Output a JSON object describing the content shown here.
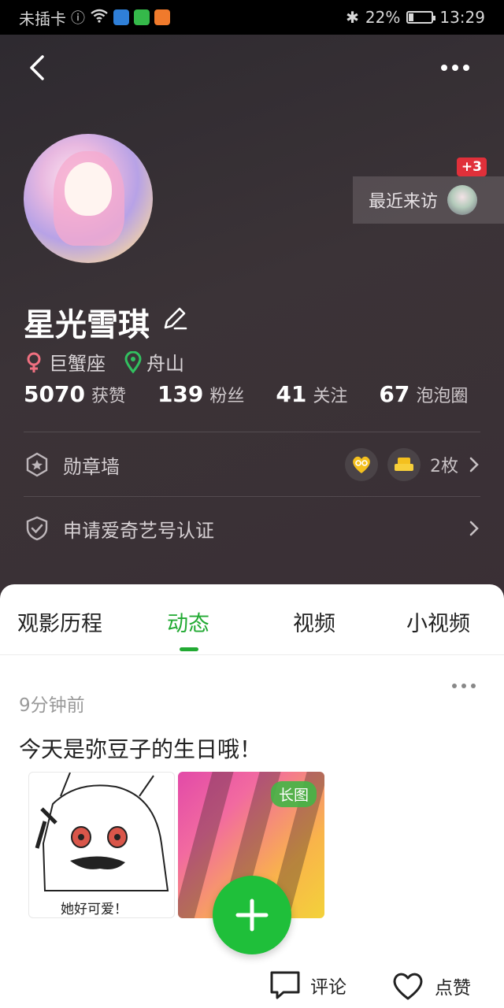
{
  "status_bar": {
    "carrier": "未插卡",
    "battery": "22%",
    "time": "13:29",
    "battery_level": 0.22
  },
  "profile": {
    "username": "星光雪琪",
    "zodiac": "巨蟹座",
    "location": "舟山",
    "stats": [
      {
        "value": "5070",
        "label": "获赞"
      },
      {
        "value": "139",
        "label": "粉丝"
      },
      {
        "value": "41",
        "label": "关注"
      },
      {
        "value": "67",
        "label": "泡泡圈"
      }
    ],
    "visitors_label": "最近来访",
    "visitors_badge": "+3"
  },
  "rows": {
    "medal_wall": "勋章墙",
    "medal_count": "2枚",
    "verify": "申请爱奇艺号认证"
  },
  "tabs": [
    "观影历程",
    "动态",
    "视频",
    "小视频"
  ],
  "active_tab": 1,
  "post": {
    "time": "9分钟前",
    "text": "今天是弥豆子的生日哦！",
    "image1_caption": "她好可爱！",
    "long_image_badge": "长图"
  },
  "actions": {
    "comment": "评论",
    "like": "点赞"
  },
  "colors": {
    "accent": "#22aa33",
    "fab": "#1fbf3a",
    "badge": "#e0303a"
  }
}
